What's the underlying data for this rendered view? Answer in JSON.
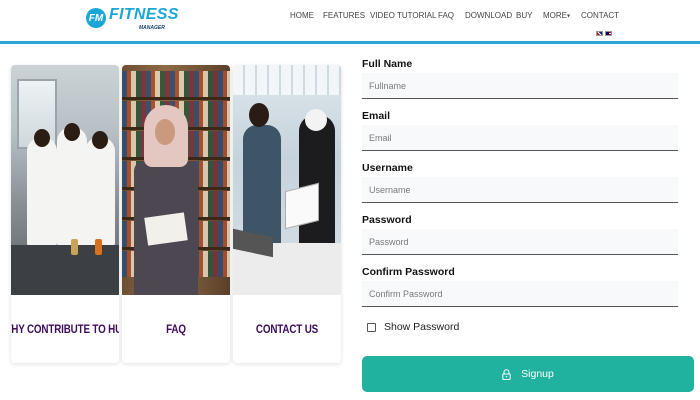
{
  "header": {
    "logo_badge": "FM",
    "logo_title": "FITNESS",
    "logo_subtitle": "MANAGER",
    "nav": [
      {
        "label": "HOME"
      },
      {
        "label": "FEATURES"
      },
      {
        "label": "VIDEO TUTORIAL"
      },
      {
        "label": "FAQ"
      },
      {
        "label": "DOWNLOAD"
      },
      {
        "label": "BUY"
      },
      {
        "label": "MORE"
      },
      {
        "label": "CONTACT"
      }
    ],
    "languages": [
      "uk-flag-icon",
      "malaysia-flag-icon"
    ]
  },
  "cards": [
    {
      "label": "WHY CONTRIBUTE TO HU?",
      "photo": "laboratory-students"
    },
    {
      "label": "FAQ",
      "photo": "library-reader"
    },
    {
      "label": "CONTACT US",
      "photo": "office-meeting"
    }
  ],
  "form": {
    "fullname": {
      "label": "Full Name",
      "placeholder": "Fullname"
    },
    "email": {
      "label": "Email",
      "placeholder": "Email"
    },
    "username": {
      "label": "Username",
      "placeholder": "Username"
    },
    "password": {
      "label": "Password",
      "placeholder": "Password"
    },
    "confirm": {
      "label": "Confirm Password",
      "placeholder": "Confirm Password"
    },
    "show_password": "Show Password",
    "signup": "Signup",
    "signup_icon": "lock-icon"
  },
  "colors": {
    "accent": "#20b29f",
    "header_border": "#2fa4d8",
    "card_label": "#3d0c5a",
    "brand": "#1aa7d8"
  }
}
